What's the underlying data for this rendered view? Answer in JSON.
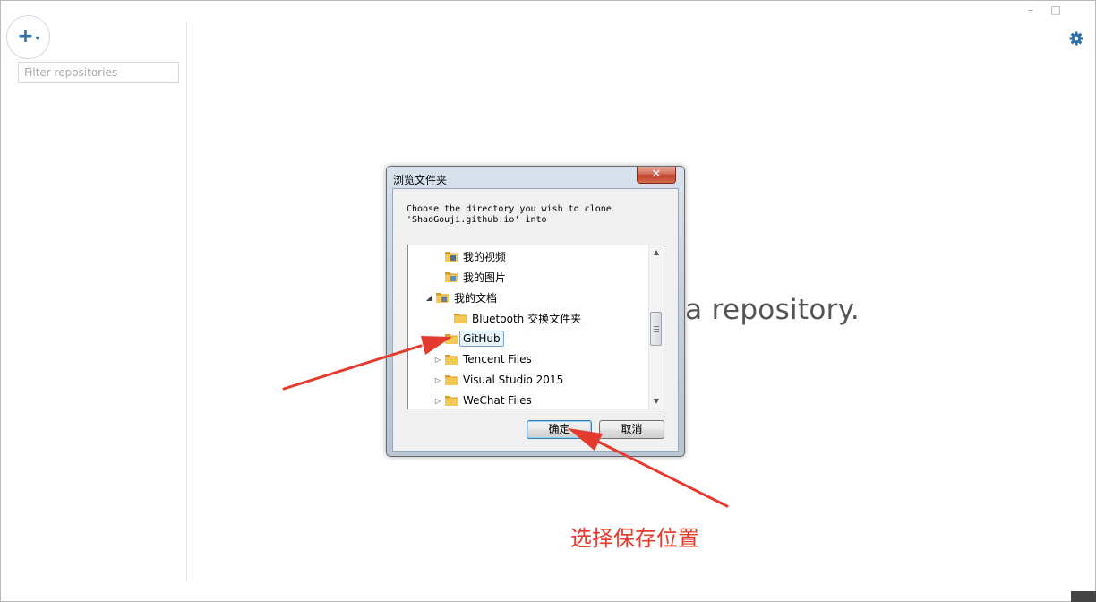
{
  "sidebar": {
    "add_button_symbol": "+",
    "add_button_caret": "▾",
    "filter_placeholder": "Filter repositories"
  },
  "window_controls": {
    "minimize": "–",
    "maximize": "□"
  },
  "main": {
    "background_message": "g a repository."
  },
  "dialog": {
    "title": "浏览文件夹",
    "close_symbol": "✕",
    "instruction": "Choose the directory you wish to clone\n'ShaoGouji.github.io' into",
    "tree_items": [
      {
        "label": "我的视频",
        "icon": "video-folder-icon",
        "expander": ""
      },
      {
        "label": "我的图片",
        "icon": "picture-folder-icon",
        "expander": ""
      },
      {
        "label": "我的文档",
        "icon": "documents-folder-icon",
        "expander": "◢"
      },
      {
        "label": "Bluetooth 交换文件夹",
        "icon": "folder-icon",
        "expander": ""
      },
      {
        "label": "GitHub",
        "icon": "folder-icon",
        "expander": "▷",
        "selected": true
      },
      {
        "label": "Tencent Files",
        "icon": "folder-icon",
        "expander": "▷"
      },
      {
        "label": "Visual Studio 2015",
        "icon": "folder-icon",
        "expander": "▷"
      },
      {
        "label": "WeChat Files",
        "icon": "folder-icon",
        "expander": "▷"
      }
    ],
    "ok_label": "确定",
    "cancel_label": "取消",
    "scroll_up": "▲",
    "scroll_down": "▼"
  },
  "annotation": {
    "text": "选择保存位置",
    "color": "#e53b2e"
  },
  "colors": {
    "accent": "#2f6fa8",
    "annotation_red": "#e53b2e"
  }
}
